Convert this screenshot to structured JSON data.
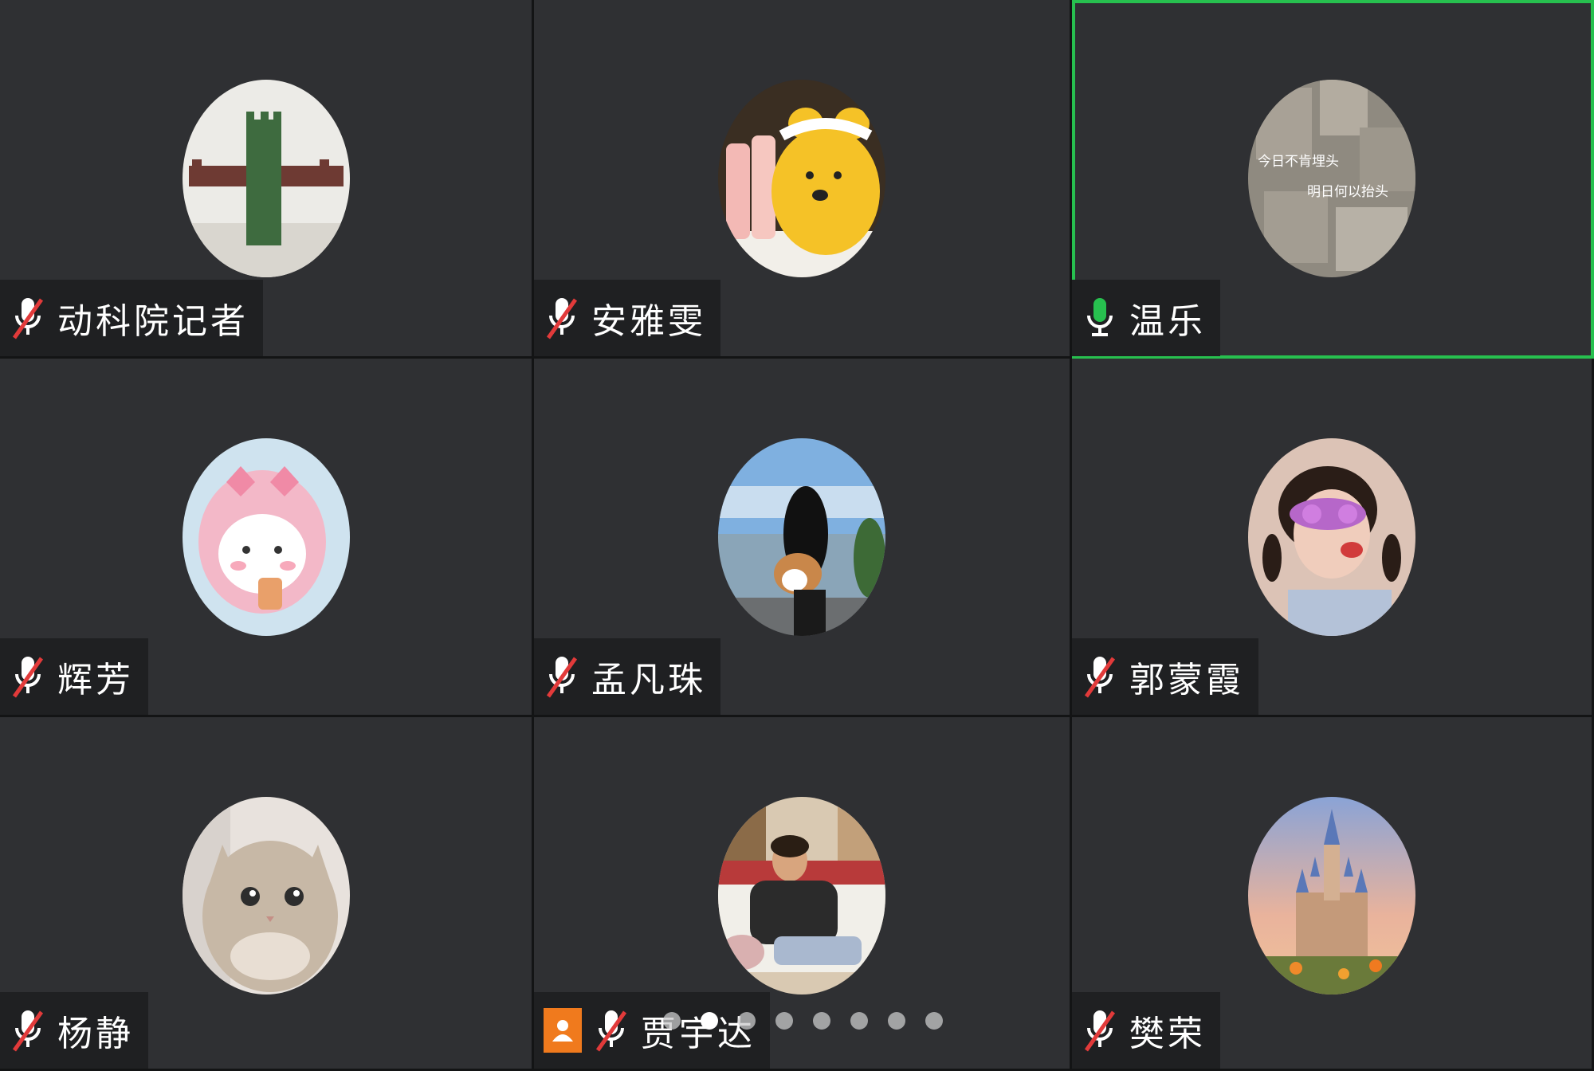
{
  "participants": [
    {
      "name": "动科院记者",
      "muted": true,
      "speaking": false,
      "host": false,
      "avatar": "lego-brick-avatar"
    },
    {
      "name": "安雅雯",
      "muted": true,
      "speaking": false,
      "host": false,
      "avatar": "yellow-bear-avatar"
    },
    {
      "name": "温乐",
      "muted": false,
      "speaking": true,
      "host": false,
      "avatar": "collage-text-avatar",
      "avatar_text_line1": "今日不肯埋头",
      "avatar_text_line2": "明日何以抬头"
    },
    {
      "name": "辉芳",
      "muted": true,
      "speaking": false,
      "host": false,
      "avatar": "pink-bunny-avatar"
    },
    {
      "name": "孟凡珠",
      "muted": true,
      "speaking": false,
      "host": false,
      "avatar": "girl-with-dog-avatar"
    },
    {
      "name": "郭蒙霞",
      "muted": true,
      "speaking": false,
      "host": false,
      "avatar": "girl-flower-glasses-avatar"
    },
    {
      "name": "杨静",
      "muted": true,
      "speaking": false,
      "host": false,
      "avatar": "grey-cat-avatar"
    },
    {
      "name": "贾宇达",
      "muted": true,
      "speaking": false,
      "host": true,
      "avatar": "man-on-sofa-avatar"
    },
    {
      "name": "樊荣",
      "muted": true,
      "speaking": false,
      "host": false,
      "avatar": "castle-avatar"
    }
  ],
  "pager": {
    "count": 8,
    "active": 1
  },
  "colors": {
    "tile_bg": "#2f3033",
    "speaking_border": "#27c04f",
    "muted_red": "#e23a3a",
    "mic_green": "#27c04f",
    "host_orange": "#f07a1d"
  }
}
